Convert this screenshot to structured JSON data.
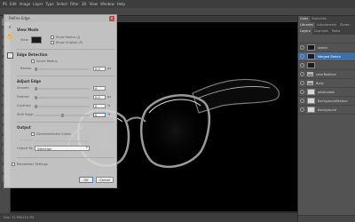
{
  "menubar": {
    "items": [
      "PS",
      "Edit",
      "Image",
      "Layer",
      "Type",
      "Select",
      "Filter",
      "3D",
      "View",
      "Window",
      "Help"
    ]
  },
  "document_tab": {
    "label": ""
  },
  "dialog": {
    "title": "Refine Edge",
    "view_mode": {
      "section": "View Mode",
      "view_label": "View:",
      "show_radius": "Show Radius (J)",
      "show_original": "Show Original (P)"
    },
    "edge_detection": {
      "section": "Edge Detection",
      "smart_radius": "Smart Radius",
      "radius_label": "Radius:",
      "radius_value": "0.0",
      "radius_unit": "px"
    },
    "adjust_edge": {
      "section": "Adjust Edge",
      "fields": [
        {
          "label": "Smooth:",
          "value": "0",
          "unit": "",
          "level": 0
        },
        {
          "label": "Feather:",
          "value": "0.0",
          "unit": "px",
          "level": 0
        },
        {
          "label": "Contrast:",
          "value": "0",
          "unit": "%",
          "level": 0
        },
        {
          "label": "Shift Edge:",
          "value": "0",
          "unit": "%",
          "level": 0.5
        }
      ]
    },
    "output": {
      "section": "Output",
      "decontaminate": "Decontaminate Colors",
      "amount_label": "Amount:",
      "output_to_label": "Output To:",
      "output_to_value": "Selection"
    },
    "remember": "Remember Settings",
    "ok": "OK",
    "cancel": "Cancel"
  },
  "panels": {
    "tabs": [
      "Color",
      "Swatches"
    ],
    "lower_tabs": [
      "Libraries",
      "Adjustments",
      "Styles"
    ],
    "layer_tabs": [
      "Layers",
      "Channels",
      "Paths"
    ],
    "layers": [
      {
        "name": "sketch",
        "thumb": "black",
        "selected": false
      },
      {
        "name": "Merged Sketch",
        "thumb": "black",
        "selected": true
      },
      {
        "name": "",
        "thumb": "black",
        "selected": false
      },
      {
        "name": "colorBoolean",
        "thumb": "folder",
        "selected": false
      },
      {
        "name": "Body",
        "thumb": "folder",
        "selected": false
      },
      {
        "name": "whiteLabel",
        "thumb": "white",
        "selected": false
      },
      {
        "name": "BackgroundTexture",
        "thumb": "white",
        "selected": false
      },
      {
        "name": "Background",
        "thumb": "white",
        "selected": false
      }
    ]
  },
  "statusbar": {
    "text": "Doc: 12.9M/110.7M"
  },
  "colors": {
    "selection": "#3d6fa8",
    "dialog_bg": "#d6d6d6",
    "close_button": "#c7433d"
  }
}
